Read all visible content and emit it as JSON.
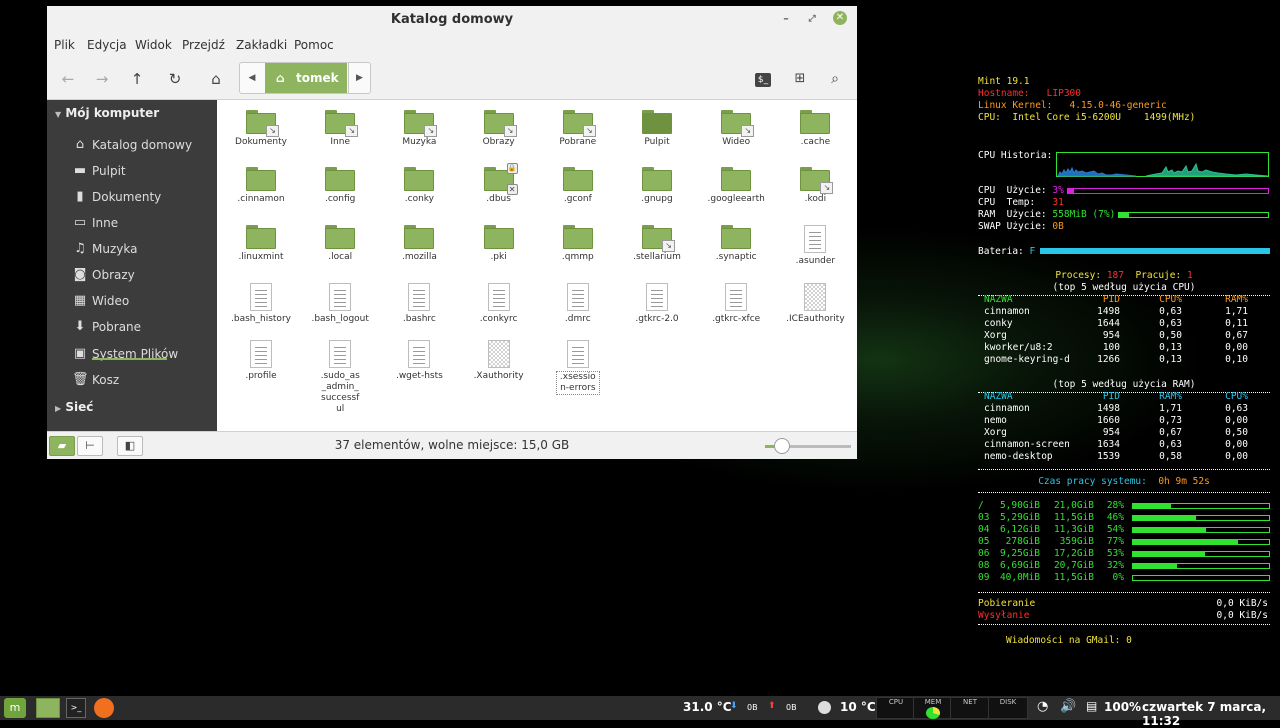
{
  "window": {
    "title": "Katalog domowy",
    "menu": [
      "Plik",
      "Edycja",
      "Widok",
      "Przejdź",
      "Zakładki",
      "Pomoc"
    ],
    "path_crumb": "tomek",
    "status": "37 elementów, wolne miejsce: 15,0 GB",
    "zoom_level": 0.2,
    "accent": "#8fb45f"
  },
  "sidebar": {
    "section_computer": "Mój komputer",
    "section_network": "Sieć",
    "items": [
      {
        "label": "Katalog domowy",
        "icon": "home-icon"
      },
      {
        "label": "Pulpit",
        "icon": "desktop-icon"
      },
      {
        "label": "Dokumenty",
        "icon": "documents-icon"
      },
      {
        "label": "Inne",
        "icon": "folder-icon"
      },
      {
        "label": "Muzyka",
        "icon": "music-icon"
      },
      {
        "label": "Obrazy",
        "icon": "pictures-icon"
      },
      {
        "label": "Wideo",
        "icon": "video-icon"
      },
      {
        "label": "Pobrane",
        "icon": "download-icon"
      },
      {
        "label": "System Plików",
        "icon": "drive-icon"
      },
      {
        "label": "Kosz",
        "icon": "trash-icon"
      }
    ]
  },
  "files": [
    {
      "name": "Dokumenty",
      "type": "folder-link"
    },
    {
      "name": "Inne",
      "type": "folder-link"
    },
    {
      "name": "Muzyka",
      "type": "folder-link"
    },
    {
      "name": "Obrazy",
      "type": "folder-link"
    },
    {
      "name": "Pobrane",
      "type": "folder-link"
    },
    {
      "name": "Pulpit",
      "type": "desktop"
    },
    {
      "name": "Wideo",
      "type": "folder-link"
    },
    {
      "name": ".cache",
      "type": "folder"
    },
    {
      "name": ".cinnamon",
      "type": "folder"
    },
    {
      "name": ".config",
      "type": "folder"
    },
    {
      "name": ".conky",
      "type": "folder"
    },
    {
      "name": ".dbus",
      "type": "folder-locked"
    },
    {
      "name": ".gconf",
      "type": "folder"
    },
    {
      "name": ".gnupg",
      "type": "folder"
    },
    {
      "name": ".googleearth",
      "type": "folder"
    },
    {
      "name": ".kodi",
      "type": "folder-link"
    },
    {
      "name": ".linuxmint",
      "type": "folder"
    },
    {
      "name": ".local",
      "type": "folder"
    },
    {
      "name": ".mozilla",
      "type": "folder"
    },
    {
      "name": ".pki",
      "type": "folder"
    },
    {
      "name": ".qmmp",
      "type": "folder"
    },
    {
      "name": ".stellarium",
      "type": "folder-link"
    },
    {
      "name": ".synaptic",
      "type": "folder"
    },
    {
      "name": ".asunder",
      "type": "doc"
    },
    {
      "name": ".bash_history",
      "type": "doc"
    },
    {
      "name": ".bash_logout",
      "type": "doc"
    },
    {
      "name": ".bashrc",
      "type": "doc"
    },
    {
      "name": ".conkyrc",
      "type": "doc"
    },
    {
      "name": ".dmrc",
      "type": "doc"
    },
    {
      "name": ".gtkrc-2.0",
      "type": "doc"
    },
    {
      "name": ".gtkrc-xfce",
      "type": "doc"
    },
    {
      "name": ".ICEauthority",
      "type": "doc-binary"
    },
    {
      "name": ".profile",
      "type": "doc"
    },
    {
      "name": ".sudo_as_admin_successful",
      "type": "doc"
    },
    {
      "name": ".wget-hsts",
      "type": "doc"
    },
    {
      "name": ".Xauthority",
      "type": "doc-binary"
    },
    {
      "name": ".xsession-errors",
      "type": "doc"
    }
  ],
  "conky": {
    "distro": "Mint 19.1",
    "hostname_label": "Hostname:",
    "hostname": "LIP300",
    "kernel_label": "Linux Kernel:",
    "kernel": "4.15.0-46-generic",
    "cpu_label": "CPU:",
    "cpu_model": "Intel Core i5-6200U",
    "cpu_mhz": "1499(MHz)",
    "cpu_history_label": "CPU Historia:",
    "cpu_usage_label": "CPU  Użycie:",
    "cpu_usage": "3%",
    "cpu_usage_frac": 0.03,
    "cpu_temp_label": "CPU  Temp:",
    "cpu_temp": "31",
    "ram_label": "RAM  Użycie:",
    "ram_usage": "558MiB (7%)",
    "ram_frac": 0.07,
    "swap_label": "SWAP Użycie:",
    "swap_usage": "0B",
    "battery_label": "Bateria:",
    "battery_state": "F",
    "battery_frac": 1.0,
    "procs_label": "Procesy:",
    "procs": "187",
    "running_label": "Pracuje:",
    "running": "1",
    "top_cpu_title": "(top 5 według użycia CPU)",
    "top_cpu_headers": [
      "NAZWA",
      "PID",
      "CPU%",
      "RAM%"
    ],
    "top_cpu": [
      [
        "cinnamon",
        "1498",
        "0,63",
        "1,71"
      ],
      [
        "conky",
        "1644",
        "0,63",
        "0,11"
      ],
      [
        "Xorg",
        "954",
        "0,50",
        "0,67"
      ],
      [
        "kworker/u8:2",
        "100",
        "0,13",
        "0,00"
      ],
      [
        "gnome-keyring-d",
        "1266",
        "0,13",
        "0,10"
      ]
    ],
    "top_ram_title": "(top 5 według użycia RAM)",
    "top_ram_headers": [
      "NAZWA",
      "PID",
      "RAM%",
      "CPU%"
    ],
    "top_ram": [
      [
        "cinnamon",
        "1498",
        "1,71",
        "0,63"
      ],
      [
        "nemo",
        "1660",
        "0,73",
        "0,00"
      ],
      [
        "Xorg",
        "954",
        "0,67",
        "0,50"
      ],
      [
        "cinnamon-screen",
        "1634",
        "0,63",
        "0,00"
      ],
      [
        "nemo-desktop",
        "1539",
        "0,58",
        "0,00"
      ]
    ],
    "uptime_label": "Czas pracy systemu:",
    "uptime": "0h 9m 52s",
    "disks": [
      {
        "mount": "/",
        "used": "5,90GiB",
        "size": "21,0GiB",
        "pct": "28%",
        "frac": 0.28
      },
      {
        "mount": "03",
        "used": "5,29GiB",
        "size": "11,5GiB",
        "pct": "46%",
        "frac": 0.46
      },
      {
        "mount": "04",
        "used": "6,12GiB",
        "size": "11,3GiB",
        "pct": "54%",
        "frac": 0.54
      },
      {
        "mount": "05",
        "used": "278GiB",
        "size": "359GiB",
        "pct": "77%",
        "frac": 0.77
      },
      {
        "mount": "06",
        "used": "9,25GiB",
        "size": "17,2GiB",
        "pct": "53%",
        "frac": 0.53
      },
      {
        "mount": "08",
        "used": "6,69GiB",
        "size": "20,7GiB",
        "pct": "32%",
        "frac": 0.32
      },
      {
        "mount": "09",
        "used": "40,0MiB",
        "size": "11,5GiB",
        "pct": "0%",
        "frac": 0.0
      }
    ],
    "download_label": "Pobieranie",
    "download": "0,0 KiB/s",
    "upload_label": "Wysyłanie",
    "upload": "0,0 KiB/s",
    "gmail_label": "Wiadomości na GMail:",
    "gmail": "0"
  },
  "taskbar": {
    "cpu_temp": "31.0 °C",
    "down": "0B",
    "up": "0B",
    "weather": "10 °C",
    "graphs": [
      "CPU",
      "MEM",
      "NET",
      "DISK"
    ],
    "battery": "100%",
    "clock": "czwartek  7 marca, 11:32"
  }
}
